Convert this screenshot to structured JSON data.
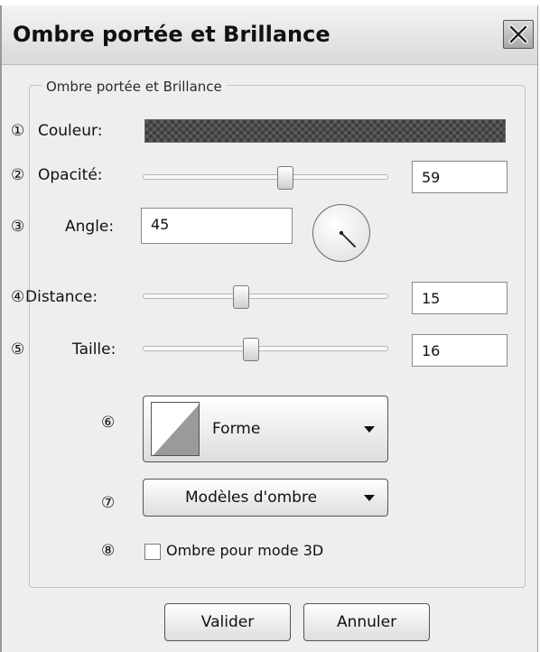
{
  "window": {
    "title": "Ombre portée et Brillance",
    "close_icon": "close-icon"
  },
  "group": {
    "label": "Ombre portée et Brillance"
  },
  "markers": [
    "①",
    "②",
    "③",
    "④",
    "⑤",
    "⑥",
    "⑦",
    "⑧"
  ],
  "color": {
    "label": "Couleur:",
    "pattern": "checkerboard",
    "swatch_colors": [
      "#5a5a5a",
      "#3e3e3e"
    ]
  },
  "opacity": {
    "label": "Opacité:",
    "value": "59",
    "slider_fraction": 0.58
  },
  "angle": {
    "label": "Angle:",
    "value": "45",
    "dial_degrees": 45
  },
  "distance": {
    "label": "Distance:",
    "value": "15",
    "slider_fraction": 0.4
  },
  "size": {
    "label": "Taille:",
    "value": "16",
    "slider_fraction": 0.44
  },
  "shape_dropdown": {
    "label": "Forme",
    "icon": "chevron-down-icon"
  },
  "presets_dropdown": {
    "label": "Modèles d'ombre",
    "icon": "chevron-down-icon"
  },
  "shadow_3d": {
    "label": "Ombre pour mode 3D",
    "checked": false
  },
  "buttons": {
    "ok": "Valider",
    "cancel": "Annuler"
  }
}
